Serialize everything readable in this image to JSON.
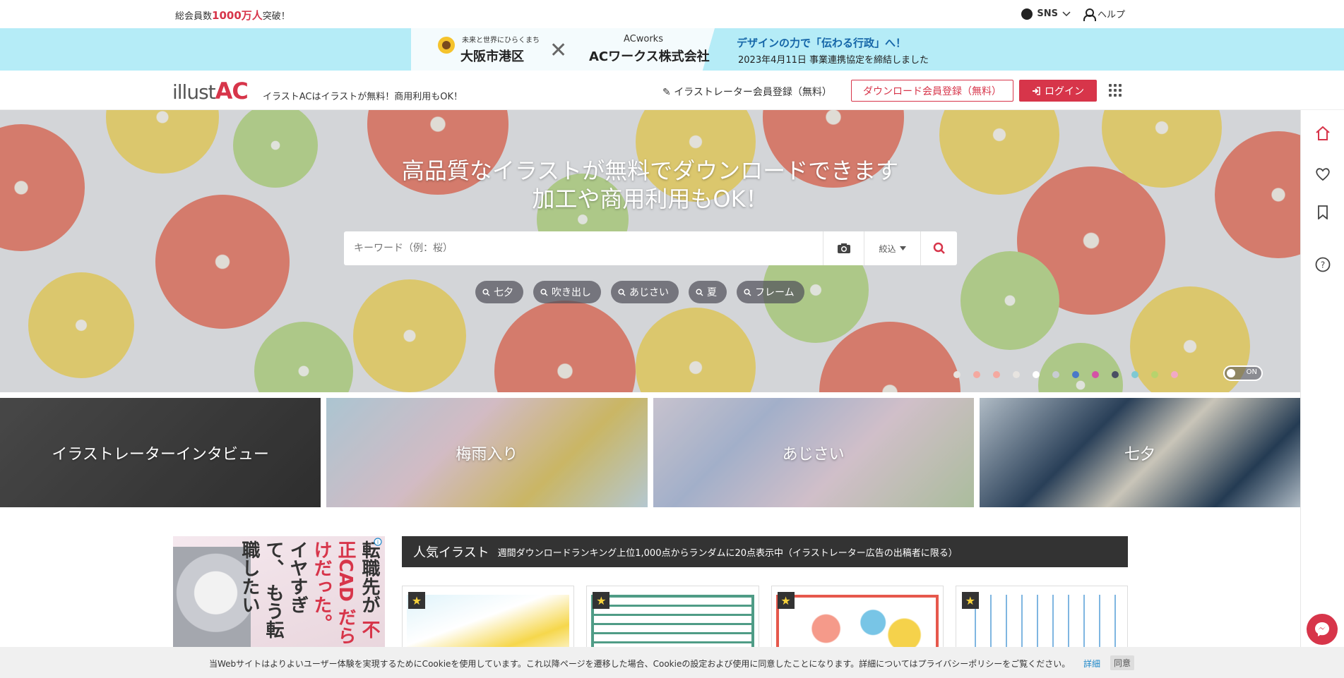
{
  "topbar": {
    "member_prefix": "総会員数",
    "member_count": "1000万人",
    "member_suffix": "突破！",
    "sns_label": "SNS",
    "help_label": "ヘルプ"
  },
  "banner": {
    "ward_caption": "未来と世界にひらくまち",
    "ward_name": "大阪市港区",
    "cross": "✕",
    "partner_logo": "ACworks",
    "partner_name": "ACワークス株式会社",
    "headline": "デザインの力で「伝わる行政」へ！",
    "subline": "2023年4月11日 事業連携協定を締結しました"
  },
  "header": {
    "logo_text": "illust",
    "logo_accent": "AC",
    "tagline": "イラストACはイラストが無料！商用利用もOK！",
    "illustrator_register": "イラストレーター会員登録（無料）",
    "download_register": "ダウンロード会員登録（無料）",
    "login": "ログイン"
  },
  "hero": {
    "title_line1": "高品質なイラストが無料でダウンロードできます",
    "title_line2": "加工や商用利用もOK！",
    "search_placeholder": "キーワード（例：桜）",
    "filter_label": "絞込",
    "tags": [
      "七夕",
      "吹き出し",
      "あじさい",
      "夏",
      "フレーム"
    ],
    "toggle_label": "ON",
    "dot_colors": [
      "#e7e4e0",
      "#f4a9a0",
      "#f4a9a0",
      "#e7e4e0",
      "#ffffff",
      "#c8ccd2",
      "#4a78c8",
      "#d452a6",
      "#4a4f63",
      "#7fc9d3",
      "#b7d36d",
      "#f2a9c6"
    ]
  },
  "categories": [
    {
      "label": "イラストレーターインタビュー"
    },
    {
      "label": "梅雨入り"
    },
    {
      "label": "あじさい"
    },
    {
      "label": "七夕"
    }
  ],
  "ad": {
    "text1": "転職先が",
    "text2": "不正CAD",
    "text3": "だらけだった。",
    "text4": "イヤすぎて、",
    "text5": "もう転職したい"
  },
  "popular": {
    "title": "人気イラスト",
    "subtitle": "週間ダウンロードランキング上位1,000点からランダムに20点表示中（イラストレーター広告の出稿者に限る）"
  },
  "thumbs": [
    {
      "name": "thumb-1"
    },
    {
      "name": "thumb-2"
    },
    {
      "name": "thumb-3"
    },
    {
      "name": "thumb-4"
    }
  ],
  "cookie": {
    "message": "当Webサイトはよりよいユーザー体験を実現するためにCookieを使用しています。これ以降ページを遷移した場合、Cookieの設定および使用に同意したことになります。詳細についてはプライバシーポリシーをご覧ください。",
    "detail": "詳細",
    "agree": "同意"
  },
  "colors": {
    "accent": "#d7354a",
    "banner_bg": "#b5ecf7",
    "dark_bar": "#333333"
  }
}
